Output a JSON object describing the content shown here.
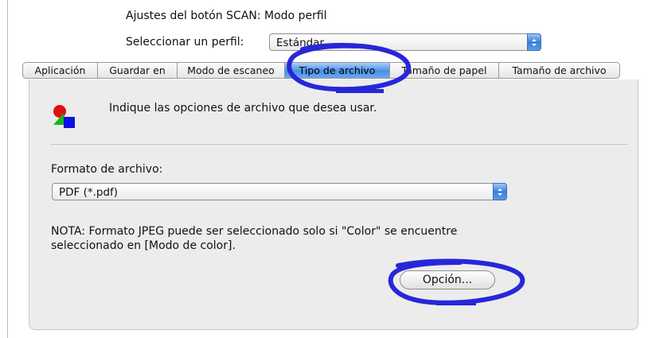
{
  "header": {
    "title": "Ajustes del botón SCAN: Modo perfil",
    "profile_label": "Seleccionar un perfil:",
    "profile_value": "Estándar"
  },
  "tabs": [
    {
      "label": "Aplicación",
      "active": false
    },
    {
      "label": "Guardar en",
      "active": false
    },
    {
      "label": "Modo de escaneo",
      "active": false
    },
    {
      "label": "Tipo de archivo",
      "active": true
    },
    {
      "label": "Tamaño de papel",
      "active": false
    },
    {
      "label": "Tamaño de archivo",
      "active": false
    }
  ],
  "pane": {
    "icon": "file-type-shapes-icon",
    "instruction": "Indique las opciones de archivo que desea usar.",
    "format_label": "Formato de archivo:",
    "format_value": "PDF (*.pdf)",
    "note": "NOTA: Formato JPEG puede ser seleccionado solo si \"Color\" se encuentre seleccionado en [Modo de color].",
    "option_button": "Opción..."
  },
  "colors": {
    "accent": "#4b8fe6",
    "annotation": "#2727d9"
  }
}
